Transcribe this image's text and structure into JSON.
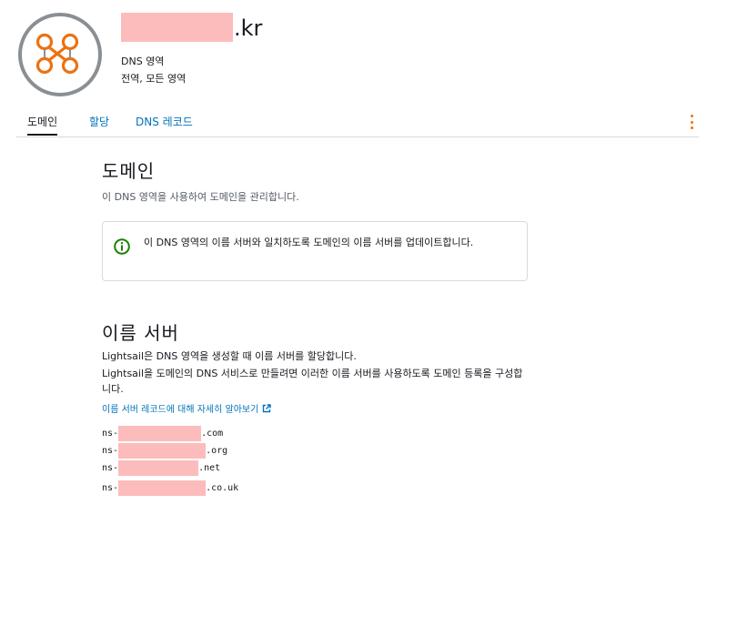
{
  "header": {
    "tld": ".kr",
    "subtitle": "DNS 영역",
    "scope": "전역, 모든 영역"
  },
  "tabs": [
    {
      "label": "도메인",
      "active": true
    },
    {
      "label": "할당",
      "active": false
    },
    {
      "label": "DNS 레코드",
      "active": false
    }
  ],
  "domain_section": {
    "title": "도메인",
    "description": "이 DNS 영역을 사용하여 도메인을 관리합니다.",
    "info": "이 DNS 영역의 이름 서버와 일치하도록 도메인의 이름 서버를 업데이트합니다."
  },
  "nameservers_section": {
    "title": "이름 서버",
    "line1": "Lightsail은 DNS 영역을 생성할 때 이름 서버를 할당합니다.",
    "line2": "Lightsail을 도메인의 DNS 서비스로 만들려면 이러한 이름 서버를 사용하도록 도메인 등록을 구성합니다.",
    "learn_more": "이름 서버 레코드에 대해 자세히 알아보기",
    "servers": [
      {
        "prefix": "ns-",
        "suffix": ".com"
      },
      {
        "prefix": "ns-",
        "suffix": ".org"
      },
      {
        "prefix": "ns-",
        "suffix": ".net"
      },
      {
        "prefix": "ns-",
        "suffix": ".co.uk"
      }
    ]
  },
  "colors": {
    "accent": "#ec7211",
    "link": "#0073bb",
    "success": "#1d8102",
    "redaction": "#fdbcbc"
  }
}
